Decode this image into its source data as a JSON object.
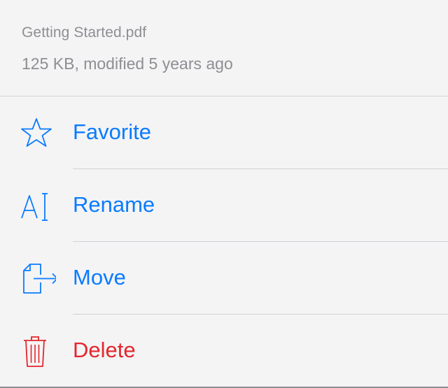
{
  "file": {
    "name": "Getting Started.pdf",
    "meta": "125 KB, modified 5 years ago"
  },
  "actions": [
    {
      "label": "Favorite",
      "icon": "star-icon",
      "color": "#0a7bff"
    },
    {
      "label": "Rename",
      "icon": "rename-icon",
      "color": "#0a7bff"
    },
    {
      "label": "Move",
      "icon": "move-icon",
      "color": "#0a7bff"
    },
    {
      "label": "Delete",
      "icon": "trash-icon",
      "color": "#e4262c"
    }
  ]
}
